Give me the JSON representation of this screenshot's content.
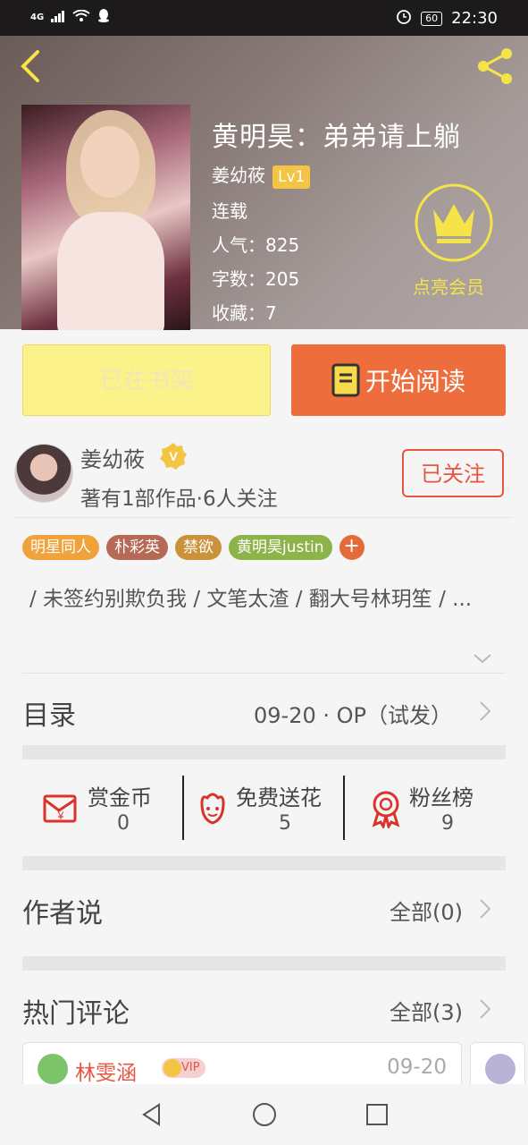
{
  "status_bar": {
    "network": "4G",
    "battery": "60",
    "time": "22:30"
  },
  "book": {
    "title": "黄明昊：弟弟请上躺",
    "author": "姜幼莜",
    "author_level": "Lv1",
    "status": "连载",
    "popularity_label": "人气：",
    "popularity": "825",
    "word_count_label": "字数：",
    "word_count": "205",
    "favorites_label": "收藏：",
    "favorites": "7",
    "vip_label": "点亮会员"
  },
  "actions": {
    "on_shelf": "已在书架",
    "start_reading": "开始阅读"
  },
  "author": {
    "name": "姜幼莜",
    "info": "著有1部作品·6人关注",
    "follow_label": "已关注"
  },
  "tags": [
    {
      "label": "明星同人",
      "color": "#f0a33a"
    },
    {
      "label": "朴彩英",
      "color": "#b66a55"
    },
    {
      "label": "禁欲",
      "color": "#c9923b"
    },
    {
      "label": "黄明昊justin",
      "color": "#8db44a"
    }
  ],
  "tag_add": "+",
  "description": "/ 未签约别欺负我 / 文笔太渣 / 翻大号林玥笙 / ...",
  "catalog": {
    "label": "目录",
    "latest": "09-20 · OP（试发）"
  },
  "stats": [
    {
      "label": "赏金币",
      "value": "0"
    },
    {
      "label": "免费送花",
      "value": "5"
    },
    {
      "label": "粉丝榜",
      "value": "9"
    }
  ],
  "author_says": {
    "label": "作者说",
    "all": "全部(0)"
  },
  "hot_comments": {
    "label": "热门评论",
    "all": "全部(3)"
  },
  "comments": [
    {
      "name": "林雯涵",
      "badge": "VIP",
      "date": "09-20"
    }
  ]
}
